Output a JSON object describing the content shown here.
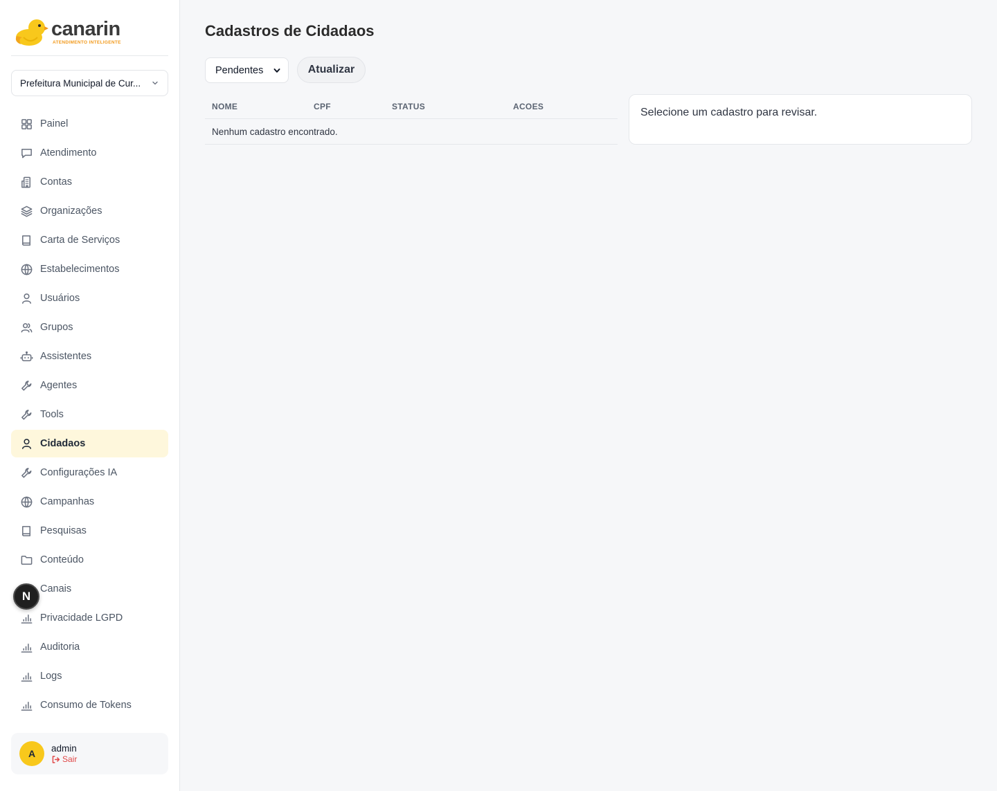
{
  "brand": {
    "name": "canarin",
    "tagline": "ATENDIMENTO INTELIGENTE",
    "accent_color": "#f8c81c",
    "tag_color": "#f29a1c"
  },
  "organization": {
    "selected": "Prefeitura Municipal de Cur..."
  },
  "nav": {
    "items": [
      {
        "label": "Painel",
        "icon": "grid-icon",
        "active": false
      },
      {
        "label": "Atendimento",
        "icon": "message-icon",
        "active": false
      },
      {
        "label": "Contas",
        "icon": "building-icon",
        "active": false
      },
      {
        "label": "Organizações",
        "icon": "layers-icon",
        "active": false
      },
      {
        "label": "Carta de Serviços",
        "icon": "book-icon",
        "active": false
      },
      {
        "label": "Estabelecimentos",
        "icon": "globe-icon",
        "active": false
      },
      {
        "label": "Usuários",
        "icon": "user-icon",
        "active": false
      },
      {
        "label": "Grupos",
        "icon": "users-icon",
        "active": false
      },
      {
        "label": "Assistentes",
        "icon": "bot-icon",
        "active": false
      },
      {
        "label": "Agentes",
        "icon": "wrench-icon",
        "active": false
      },
      {
        "label": "Tools",
        "icon": "wrench-icon",
        "active": false
      },
      {
        "label": "Cidadaos",
        "icon": "user-icon",
        "active": true
      },
      {
        "label": "Configurações IA",
        "icon": "wrench-icon",
        "active": false
      },
      {
        "label": "Campanhas",
        "icon": "globe-icon",
        "active": false
      },
      {
        "label": "Pesquisas",
        "icon": "book-icon",
        "active": false
      },
      {
        "label": "Conteúdo",
        "icon": "folder-icon",
        "active": false
      },
      {
        "label": "Canais",
        "icon": "bar-chart-icon",
        "active": false
      },
      {
        "label": "Privacidade LGPD",
        "icon": "bar-chart-icon",
        "active": false
      },
      {
        "label": "Auditoria",
        "icon": "bar-chart-icon",
        "active": false
      },
      {
        "label": "Logs",
        "icon": "bar-chart-icon",
        "active": false
      },
      {
        "label": "Consumo de Tokens",
        "icon": "bar-chart-icon",
        "active": false
      }
    ]
  },
  "dev_badge": {
    "letter": "N"
  },
  "user": {
    "initial": "A",
    "name": "admin",
    "logout_label": "Sair"
  },
  "main": {
    "title": "Cadastros de Cidadaos",
    "filter": {
      "selected": "Pendentes"
    },
    "refresh_label": "Atualizar",
    "table": {
      "columns": [
        "NOME",
        "CPF",
        "STATUS",
        "ACOES"
      ],
      "empty_message": "Nenhum cadastro encontrado."
    },
    "review_placeholder": "Selecione um cadastro para revisar."
  }
}
